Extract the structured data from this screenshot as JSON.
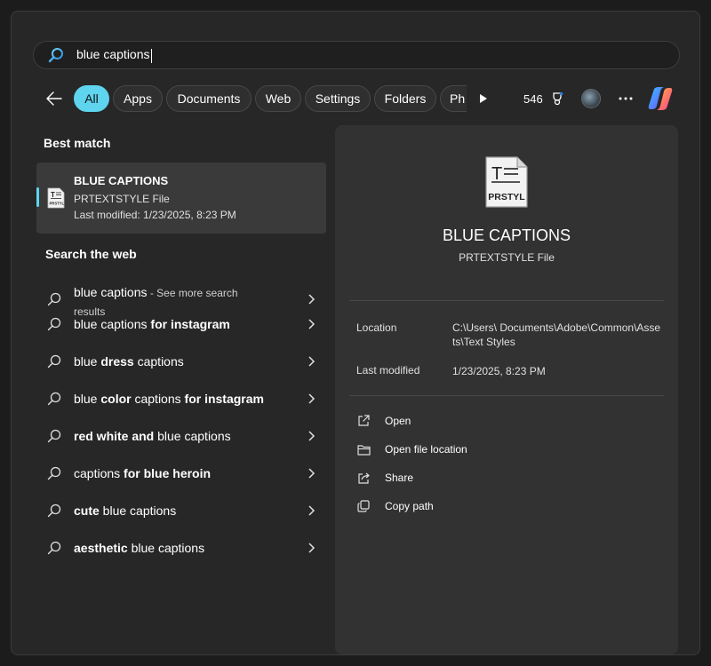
{
  "search": {
    "query": "blue captions"
  },
  "filters": {
    "chips": [
      {
        "label": "All"
      },
      {
        "label": "Apps"
      },
      {
        "label": "Documents"
      },
      {
        "label": "Web"
      },
      {
        "label": "Settings"
      },
      {
        "label": "Folders"
      },
      {
        "label": "Ph"
      }
    ],
    "points": "546"
  },
  "best_match": {
    "heading": "Best match",
    "title": "BLUE CAPTIONS",
    "type": "PRTEXTSTYLE File",
    "modified": "Last modified: 1/23/2025, 8:23 PM"
  },
  "web": {
    "heading": "Search the web",
    "first": {
      "query": "blue captions",
      "suffix": " - See more search results"
    },
    "items": [
      [
        {
          "t": "blue captions ",
          "b": false
        },
        {
          "t": "for instagram",
          "b": true
        }
      ],
      [
        {
          "t": "blue ",
          "b": false
        },
        {
          "t": "dress",
          "b": true
        },
        {
          "t": " captions",
          "b": false
        }
      ],
      [
        {
          "t": "blue ",
          "b": false
        },
        {
          "t": "color",
          "b": true
        },
        {
          "t": " captions ",
          "b": false
        },
        {
          "t": "for instagram",
          "b": true
        }
      ],
      [
        {
          "t": "red white and",
          "b": true
        },
        {
          "t": " blue captions",
          "b": false
        }
      ],
      [
        {
          "t": "captions ",
          "b": false
        },
        {
          "t": "for blue heroin",
          "b": true
        }
      ],
      [
        {
          "t": "cute",
          "b": true
        },
        {
          "t": " blue captions",
          "b": false
        }
      ],
      [
        {
          "t": "aesthetic",
          "b": true
        },
        {
          "t": " blue captions",
          "b": false
        }
      ]
    ]
  },
  "detail": {
    "icon_label": "PRSTYL",
    "title": "BLUE CAPTIONS",
    "type": "PRTEXTSTYLE File",
    "location_label": "Location",
    "location_value": "C:\\Users\\          Documents\\Adobe\\Common\\Assets\\Text Styles",
    "modified_label": "Last modified",
    "modified_value": "1/23/2025, 8:23 PM",
    "actions": [
      {
        "label": "Open"
      },
      {
        "label": "Open file location"
      },
      {
        "label": "Share"
      },
      {
        "label": "Copy path"
      }
    ]
  }
}
